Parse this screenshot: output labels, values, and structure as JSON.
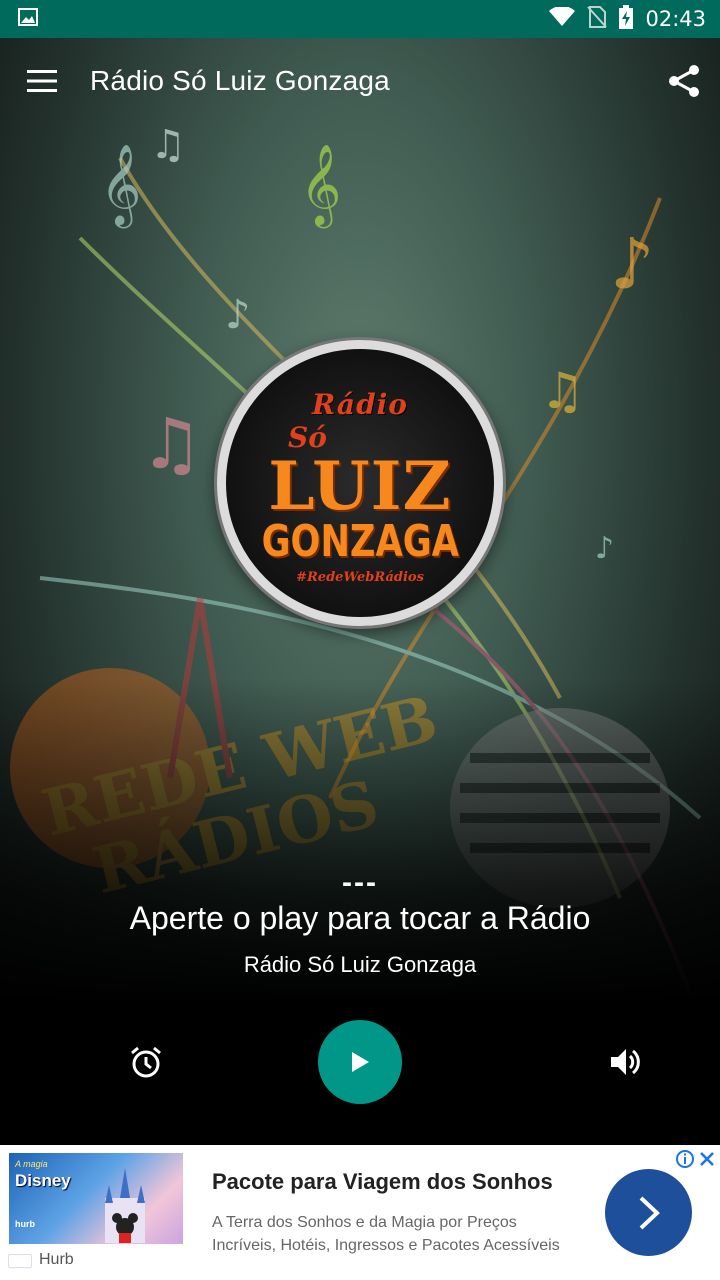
{
  "status_bar": {
    "time": "02:43",
    "icons": [
      "image-icon",
      "wifi-icon",
      "no-sim-icon",
      "battery-charging-icon"
    ]
  },
  "app_bar": {
    "title": "Rádio Só Luiz Gonzaga",
    "menu_icon": "menu-icon",
    "share_icon": "share-icon"
  },
  "logo": {
    "line1": "Rádio",
    "line2": "Só",
    "line3": "LUIZ",
    "line4": "GONZAGA",
    "tag": "#RedeWebRádios"
  },
  "player": {
    "status_dash": "---",
    "message": "Aperte o play para tocar a Rádio",
    "station": "Rádio Só Luiz Gonzaga",
    "alarm_icon": "alarm-icon",
    "play_icon": "play-icon",
    "volume_icon": "volume-icon",
    "accent_color": "#009688"
  },
  "ad": {
    "headline": "Pacote para Viagem dos Sonhos",
    "body": "A Terra dos Sonhos e da Magia por Preços Incríveis, Hotéis, Ingressos e Pacotes Acessíveis",
    "source": "Hurb",
    "image_small_text": "A magia",
    "image_main_text": "Disney",
    "image_brand": "hurb",
    "cta_icon": "chevron-right-icon",
    "cta_color": "#1e4f9a"
  }
}
